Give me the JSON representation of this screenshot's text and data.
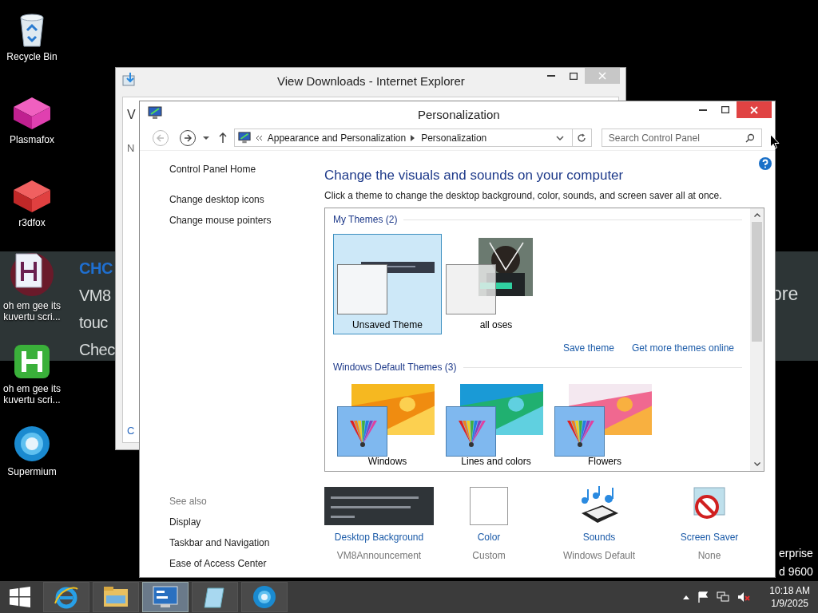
{
  "desktop_icons": [
    {
      "label": "Recycle Bin"
    },
    {
      "label": "Plasmafox"
    },
    {
      "label": "r3dfox"
    },
    {
      "label": "oh em gee its kuvertu scri..."
    },
    {
      "label": "oh em gee its kuvertu scri..."
    },
    {
      "label": "Supermium"
    }
  ],
  "banner": {
    "lines": [
      "CHC",
      "VM8",
      "touc",
      "Chec"
    ],
    "right_text": "ore"
  },
  "background_text": [
    "erprise",
    "d 9600"
  ],
  "ie_window": {
    "title": "View Downloads - Internet Explorer",
    "fragments": [
      "V",
      "N",
      "C"
    ]
  },
  "window": {
    "title": "Personalization",
    "breadcrumb": [
      "Appearance and Personalization",
      "Personalization"
    ],
    "search": {
      "placeholder": "Search Control Panel"
    },
    "nav_links": [
      "Control Panel Home",
      "Change desktop icons",
      "Change mouse pointers"
    ],
    "see_also": {
      "heading": "See also",
      "links": [
        "Display",
        "Taskbar and Navigation",
        "Ease of Access Center"
      ]
    },
    "heading": "Change the visuals and sounds on your computer",
    "subtitle": "Click a theme to change the desktop background, color, sounds, and screen saver all at once.",
    "groups": [
      {
        "title": "My Themes (2)",
        "themes": [
          {
            "name": "Unsaved Theme",
            "kind": "unsaved",
            "selected": true
          },
          {
            "name": "all oses",
            "selected": false
          }
        ],
        "links": [
          "Save theme",
          "Get more themes online"
        ]
      },
      {
        "title": "Windows Default Themes (3)",
        "themes": [
          {
            "name": "Windows",
            "kind": "default",
            "selected": false
          },
          {
            "name": "Lines and colors",
            "kind": "default",
            "selected": false
          },
          {
            "name": "Flowers",
            "kind": "default",
            "selected": false
          }
        ]
      }
    ],
    "settings": [
      {
        "label": "Desktop Background",
        "value": "VM8Announcement"
      },
      {
        "label": "Color",
        "value": "Custom"
      },
      {
        "label": "Sounds",
        "value": "Windows Default"
      },
      {
        "label": "Screen Saver",
        "value": "None"
      }
    ]
  },
  "taskbar": {
    "apps": [
      {
        "selected": false
      },
      {
        "selected": false
      },
      {
        "selected": true
      },
      {
        "selected": false
      },
      {
        "selected": false
      }
    ],
    "time": "10:18 AM",
    "date": "1/9/2025"
  }
}
